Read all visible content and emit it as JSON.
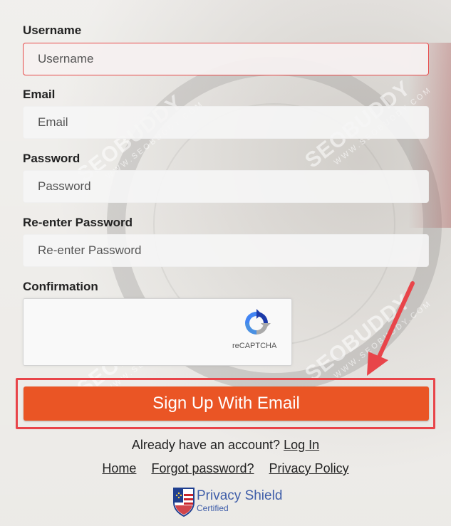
{
  "form": {
    "username": {
      "label": "Username",
      "placeholder": "Username"
    },
    "email": {
      "label": "Email",
      "placeholder": "Email"
    },
    "password": {
      "label": "Password",
      "placeholder": "Password"
    },
    "reenter": {
      "label": "Re-enter Password",
      "placeholder": "Re-enter Password"
    },
    "confirmation": {
      "label": "Confirmation"
    }
  },
  "captcha": {
    "caption": "reCAPTCHA"
  },
  "signup_button": {
    "label": "Sign Up With Email"
  },
  "account": {
    "text": "Already have an account?",
    "login_link": "Log In"
  },
  "footer_links": {
    "home": "Home",
    "forgot": "Forgot password?",
    "privacy": "Privacy Policy"
  },
  "privacy_shield": {
    "title": "Privacy Shield",
    "subtitle": "Certified"
  },
  "watermark": {
    "text": "SEOBUDDY",
    "sub": "WWW.SEOBUDDY.COM"
  },
  "colors": {
    "accent": "#ea5525",
    "highlight": "#e8454a",
    "shield_blue": "#3f5ea9"
  }
}
